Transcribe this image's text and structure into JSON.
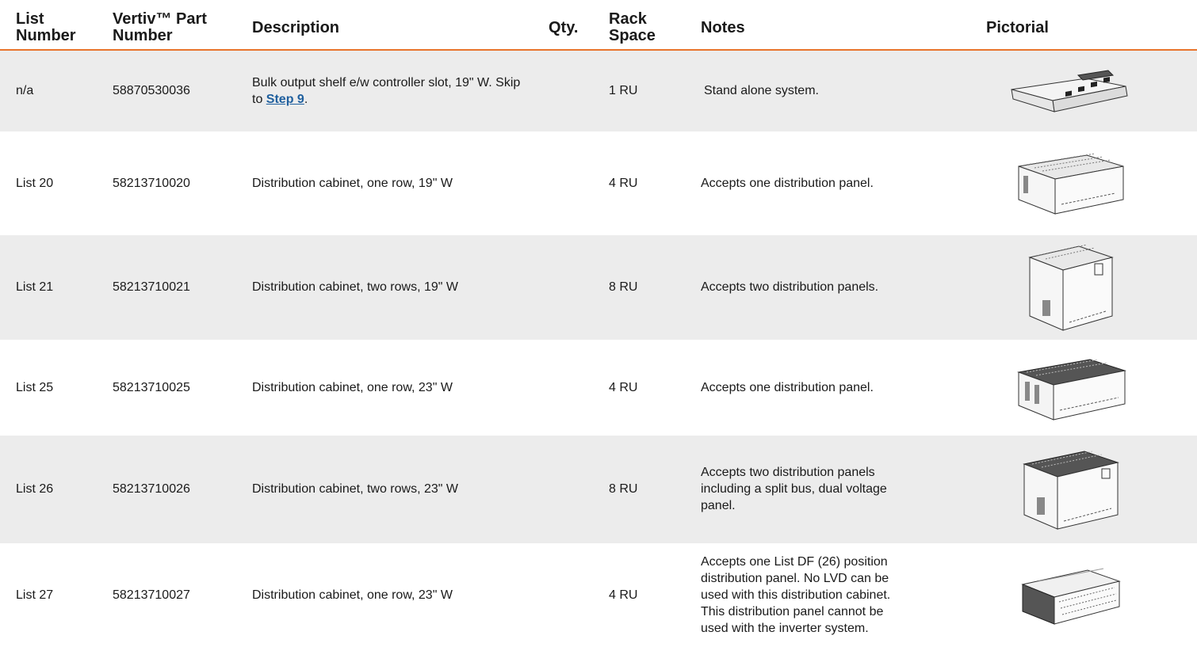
{
  "headers": {
    "list_number": "List Number",
    "part_number": "Vertiv™ Part Number",
    "description": "Description",
    "qty": "Qty.",
    "rack_space": "Rack Space",
    "notes": "Notes",
    "pictorial": "Pictorial"
  },
  "rows": [
    {
      "list": "n/a",
      "part": "58870530036",
      "desc_text": "Bulk output shelf e/w controller slot, 19\" W. Skip to ",
      "desc_link": "Step 9",
      "desc_tail": ".",
      "qty": "",
      "rack": "1 RU",
      "notes": "Stand alone system.",
      "pictorial_icon": "output-shelf-image"
    },
    {
      "list": "List 20",
      "part": "58213710020",
      "desc_text": "Distribution cabinet, one row, 19\" W",
      "qty": "",
      "rack": "4 RU",
      "notes": "Accepts one distribution panel.",
      "pictorial_icon": "cabinet-image"
    },
    {
      "list": "List 21",
      "part": "58213710021",
      "desc_text": "Distribution cabinet, two rows, 19\" W",
      "qty": "",
      "rack": "8 RU",
      "notes": "Accepts two distribution panels.",
      "pictorial_icon": "cabinet-image"
    },
    {
      "list": "List 25",
      "part": "58213710025",
      "desc_text": "Distribution cabinet, one row, 23\" W",
      "qty": "",
      "rack": "4 RU",
      "notes": "Accepts one distribution panel.",
      "pictorial_icon": "cabinet-image"
    },
    {
      "list": "List 26",
      "part": "58213710026",
      "desc_text": "Distribution cabinet, two rows, 23\" W",
      "qty": "",
      "rack": "8 RU",
      "notes": "Accepts two distribution panels including a split bus, dual voltage panel.",
      "pictorial_icon": "cabinet-image"
    },
    {
      "list": "List 27",
      "part": "58213710027",
      "desc_text": "Distribution cabinet, one row, 23\" W",
      "qty": "",
      "rack": "4 RU",
      "notes": "Accepts one List DF (26) position distribution panel. No LVD can be used with this distribution cabinet. This distribution panel cannot be used with the inverter system.",
      "pictorial_icon": "open-cabinet-image"
    }
  ],
  "colors": {
    "header_rule": "#e8742c",
    "row_shade": "#ececec",
    "link": "#1f5f9e"
  }
}
